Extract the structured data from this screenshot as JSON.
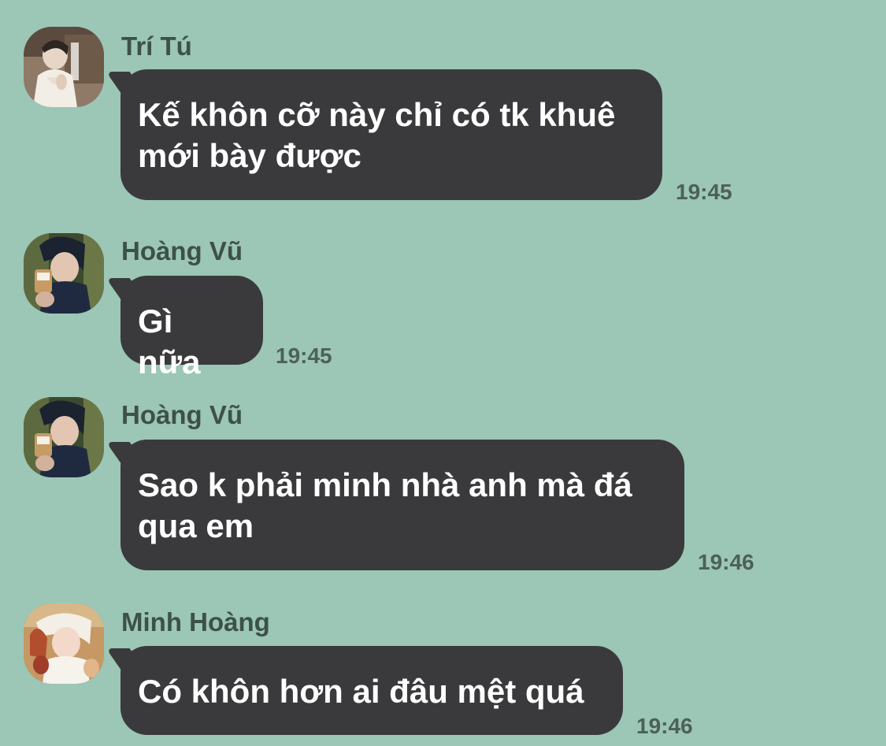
{
  "chat": {
    "messages": [
      {
        "sender": "Trí Tú",
        "avatar": "avatar-tri-tu",
        "text": "Kế khôn cỡ này chỉ có tk khuê\nmới bày được",
        "time": "19:45"
      },
      {
        "sender": "Hoàng Vũ",
        "avatar": "avatar-hoang-vu",
        "text": "Gì nữa",
        "time": "19:45"
      },
      {
        "sender": "Hoàng Vũ",
        "avatar": "avatar-hoang-vu",
        "text": "Sao k phải minh nhà anh mà đá\nqua em",
        "time": "19:46"
      },
      {
        "sender": "Minh Hoàng",
        "avatar": "avatar-minh-hoang",
        "text": "Có khôn hơn ai đâu mệt quá",
        "time": "19:46"
      }
    ]
  },
  "theme": {
    "background": "#9cc6b5",
    "bubble": "#3a3a3c",
    "bubble_text": "#ffffff",
    "sender_text": "#3d5149",
    "timestamp_text": "#4c6158"
  }
}
